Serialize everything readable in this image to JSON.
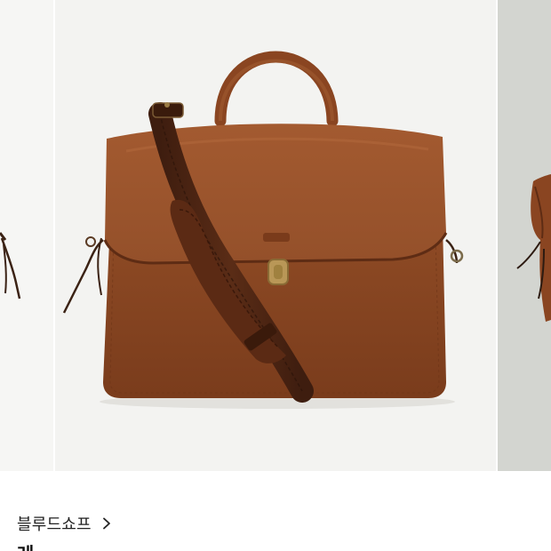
{
  "carousel": {
    "images": [
      {
        "name": "previous-product-image"
      },
      {
        "name": "leather-briefcase-main-image"
      },
      {
        "name": "next-product-image"
      }
    ]
  },
  "product": {
    "brand": "블루드쇼프",
    "brand_chevron_icon": "chevron-right-icon",
    "title": "레 …"
  },
  "colors": {
    "leather": "#8e4a24",
    "leather_dark": "#6b3418",
    "strap": "#4a2413",
    "background": "#f3f3f1"
  }
}
